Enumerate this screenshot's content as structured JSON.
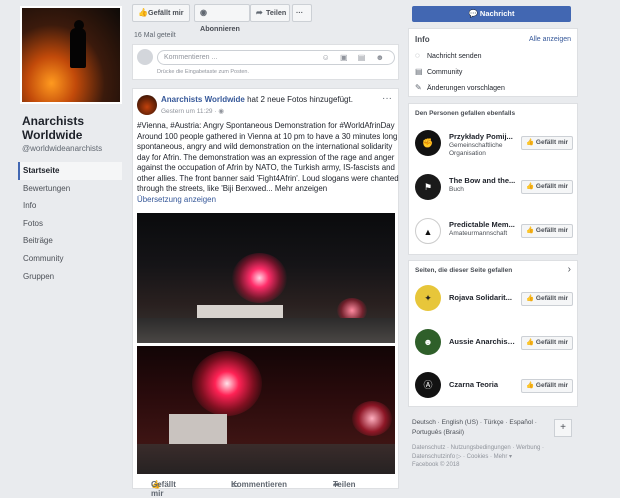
{
  "page": {
    "name": "Anarchists Worldwide",
    "handle": "@worldwideanarchists"
  },
  "nav": [
    {
      "label": "Startseite",
      "active": true
    },
    {
      "label": "Bewertungen"
    },
    {
      "label": "Info"
    },
    {
      "label": "Fotos"
    },
    {
      "label": "Beiträge"
    },
    {
      "label": "Community"
    },
    {
      "label": "Gruppen"
    }
  ],
  "actions": {
    "like": "Gefällt mir",
    "subscribe": "Abonnieren",
    "share": "Teilen",
    "more": "···"
  },
  "share_count": "16 Mal geteilt",
  "comment": {
    "placeholder": "Kommentieren ...",
    "hint": "Drücke die Eingabetaste zum Posten.",
    "icons": "☺ ▣ ▤ ☻"
  },
  "post": {
    "author": "Anarchists Worldwide",
    "header_suffix": " hat 2 neue Fotos hinzugefügt.",
    "time": "Gestern um 11:29 · ",
    "globe": "◉",
    "more": "···",
    "hashtags": "#Vienna, #Austria: Angry Spontaneous Demonstration for #WorldAfrinDay",
    "body": "Around 100 people gathered in Vienna at 10 pm to have a 30 minutes long spontaneous, angry and wild demonstration on the international solidarity day for Afrin. The demonstration was an expression of the rage and anger against the occupation of Afrin by NATO, the Turkish army, IS-fascists and other allies. The front banner said 'Fight4Afrin'. Loud slogans were chanted through the streets, like 'Biji Berxwed... Mehr anzeigen",
    "translate": "Übersetzung anzeigen",
    "action_like": "Gefällt mir",
    "action_comment": "Kommentieren",
    "action_share": "Teilen"
  },
  "sidebar": {
    "message_button": "Nachricht",
    "info_title": "Info",
    "info_link": "Alle anzeigen",
    "info_rows": [
      "Nachricht senden",
      "Community",
      "Änderungen vorschlagen"
    ],
    "liked_title": "Den Personen gefallen ebenfalls",
    "liked": [
      {
        "name": "Przykłady Pomij...",
        "sub": "Gemeinschaftliche Organisation",
        "button": "Gefällt mir"
      },
      {
        "name": "The Bow and the...",
        "sub": "Buch",
        "button": "Gefällt mir"
      },
      {
        "name": "Predictable Mem...",
        "sub": "Amateurmannschaft",
        "button": "Gefällt mir"
      }
    ],
    "pages_title": "Seiten, die dieser Seite gefallen",
    "pages_chevron": "›",
    "pages": [
      {
        "name": "Rojava Solidarit...",
        "button": "Gefällt mir"
      },
      {
        "name": "Aussie Anarchist...",
        "button": "Gefällt mir"
      },
      {
        "name": "Czarna Teoria",
        "button": "Gefällt mir"
      }
    ],
    "footer_langs": "Deutsch · English (US) · Türkçe · Español · Português (Brasil)",
    "footer_plus": "+",
    "footer_links": "Datenschutz · Nutzungsbedingungen · Werbung · Datenschutzinfo ▷ · Cookies · Mehr ▾",
    "footer_copy": "Facebook © 2018"
  },
  "colors": {
    "brand": "#4267b2",
    "link": "#365899",
    "background": "#e9ebee"
  }
}
